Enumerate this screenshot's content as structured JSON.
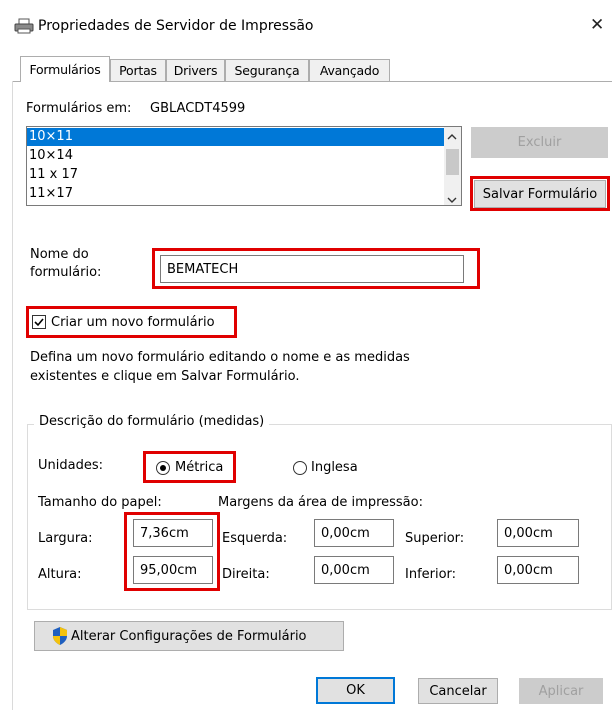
{
  "window": {
    "title": "Propriedades de Servidor de Impressão",
    "printer_icon": "printer-icon",
    "close_label": "✕"
  },
  "tabs": [
    {
      "label": "Formulários",
      "active": true
    },
    {
      "label": "Portas",
      "active": false
    },
    {
      "label": "Drivers",
      "active": false
    },
    {
      "label": "Segurança",
      "active": false
    },
    {
      "label": "Avançado",
      "active": false
    }
  ],
  "forms_on": {
    "label": "Formulários em:",
    "server": "GBLACDT4599"
  },
  "form_list": {
    "items": [
      "10×11",
      "10×14",
      "11 x 17",
      "11×17"
    ],
    "selected_index": 0
  },
  "buttons": {
    "delete": "Excluir",
    "save_form": "Salvar Formulário",
    "change_settings": "Alterar Configurações de Formulário",
    "ok": "OK",
    "cancel": "Cancelar",
    "apply": "Aplicar"
  },
  "form_name": {
    "label_line1": "Nome do",
    "label_line2": "formulário:",
    "value": "BEMATECH"
  },
  "create_new": {
    "label": "Criar um novo formulário",
    "checked": true
  },
  "hint": {
    "line1": "Defina um novo formulário editando o nome e as medidas",
    "line2": "existentes e clique em Salvar Formulário."
  },
  "description": {
    "legend": "Descrição do formulário (medidas)",
    "units_label": "Unidades:",
    "metric_label": "Métrica",
    "english_label": "Inglesa",
    "selected_unit": "metric",
    "paper_size_label": "Tamanho do papel:",
    "margins_label": "Margens da área de impressão:",
    "width_label": "Largura:",
    "width_value": "7,36cm",
    "height_label": "Altura:",
    "height_value": "95,00cm",
    "left_label": "Esquerda:",
    "left_value": "0,00cm",
    "right_label": "Direita:",
    "right_value": "0,00cm",
    "top_label": "Superior:",
    "top_value": "0,00cm",
    "bottom_label": "Inferior:",
    "bottom_value": "0,00cm"
  },
  "colors": {
    "highlight": "#e00000",
    "selection": "#0078d7",
    "shield_blue": "#1f5fbf",
    "shield_yellow": "#f4c20d"
  }
}
